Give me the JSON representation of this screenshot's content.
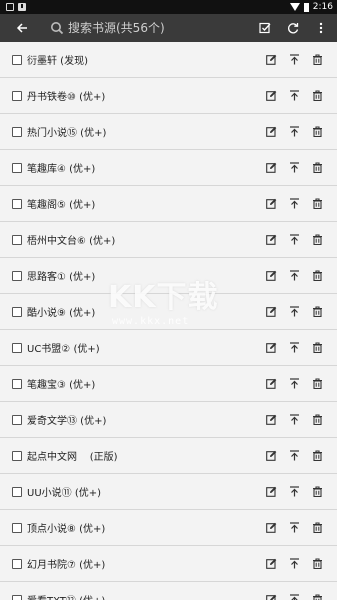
{
  "statusbar": {
    "time": "2:16"
  },
  "toolbar": {
    "search_placeholder": "搜索书源(共56个)",
    "icons": [
      "back-arrow-icon",
      "search-icon",
      "select-all-icon",
      "refresh-icon",
      "more-vert-icon"
    ]
  },
  "sources": [
    {
      "name": "衍墨轩 (发现)"
    },
    {
      "name": "丹书铁卷⑩ (优+)"
    },
    {
      "name": "热门小说⑮ (优+)"
    },
    {
      "name": "笔趣库④ (优+)"
    },
    {
      "name": "笔趣阁⑤ (优+)"
    },
    {
      "name": "梧州中文台⑥ (优+)"
    },
    {
      "name": "思路客① (优+)"
    },
    {
      "name": "酷小说⑨ (优+)"
    },
    {
      "name": "UC书盟② (优+)"
    },
    {
      "name": "笔趣宝③ (优+)"
    },
    {
      "name": "爱奇文学⑬ (优+)"
    },
    {
      "name": "起点中文网    (正版)"
    },
    {
      "name": "UU小说⑪ (优+)"
    },
    {
      "name": "顶点小说⑧ (优+)"
    },
    {
      "name": "幻月书院⑦ (优+)"
    },
    {
      "name": "爱看TXT⑫ (优+)"
    }
  ],
  "watermark": {
    "logo": "KK下载",
    "url": "www.kkx.net"
  }
}
